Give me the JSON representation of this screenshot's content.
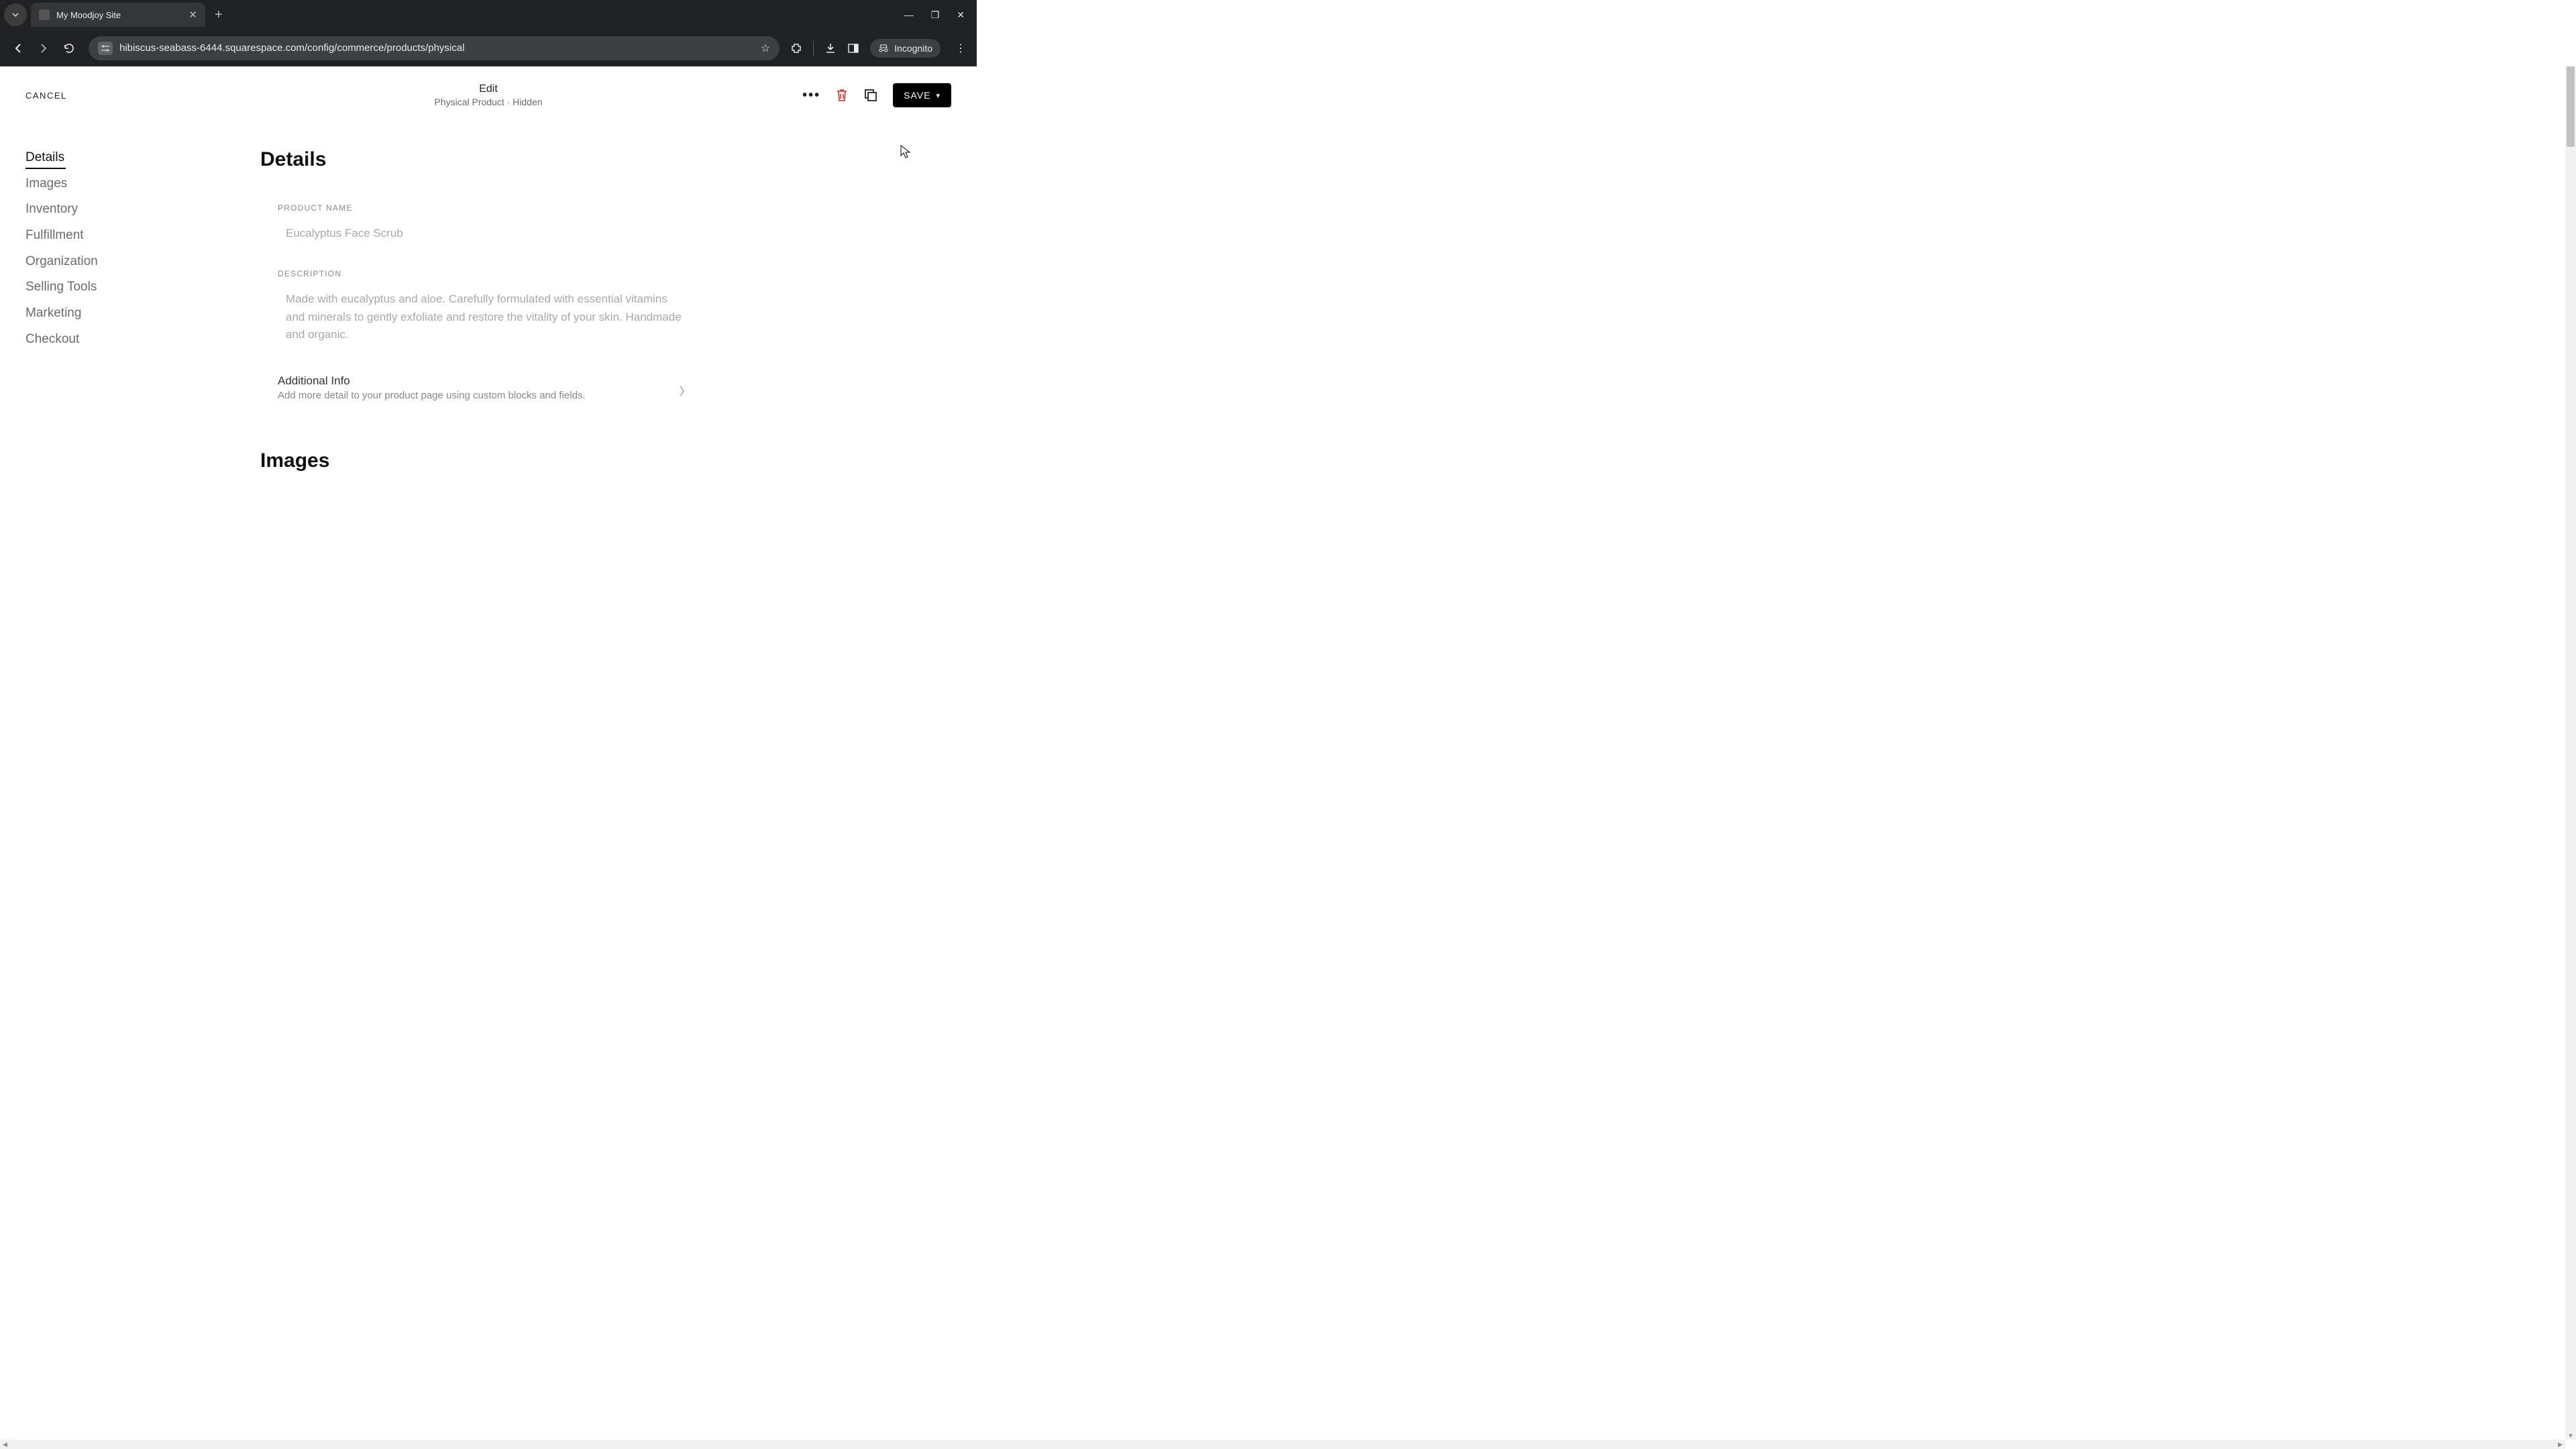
{
  "browser": {
    "tab_title": "My Moodjoy Site",
    "url": "hibiscus-seabass-6444.squarespace.com/config/commerce/products/physical",
    "incognito_label": "Incognito"
  },
  "header": {
    "cancel": "CANCEL",
    "title": "Edit",
    "subtitle": "Physical Product · Hidden",
    "save": "SAVE"
  },
  "sidebar": {
    "items": [
      {
        "label": "Details",
        "active": true
      },
      {
        "label": "Images",
        "active": false
      },
      {
        "label": "Inventory",
        "active": false
      },
      {
        "label": "Fulfillment",
        "active": false
      },
      {
        "label": "Organization",
        "active": false
      },
      {
        "label": "Selling Tools",
        "active": false
      },
      {
        "label": "Marketing",
        "active": false
      },
      {
        "label": "Checkout",
        "active": false
      }
    ]
  },
  "main": {
    "details_heading": "Details",
    "product_name_label": "PRODUCT NAME",
    "product_name_value": "Eucalyptus Face Scrub",
    "description_label": "DESCRIPTION",
    "description_value": "Made with eucalyptus and aloe. Carefully formulated with essential vitamins and minerals to gently exfoliate and restore the vitality of your skin. Handmade and organic.",
    "additional_info_title": "Additional Info",
    "additional_info_sub": "Add more detail to your product page using custom blocks and fields.",
    "images_heading": "Images"
  }
}
